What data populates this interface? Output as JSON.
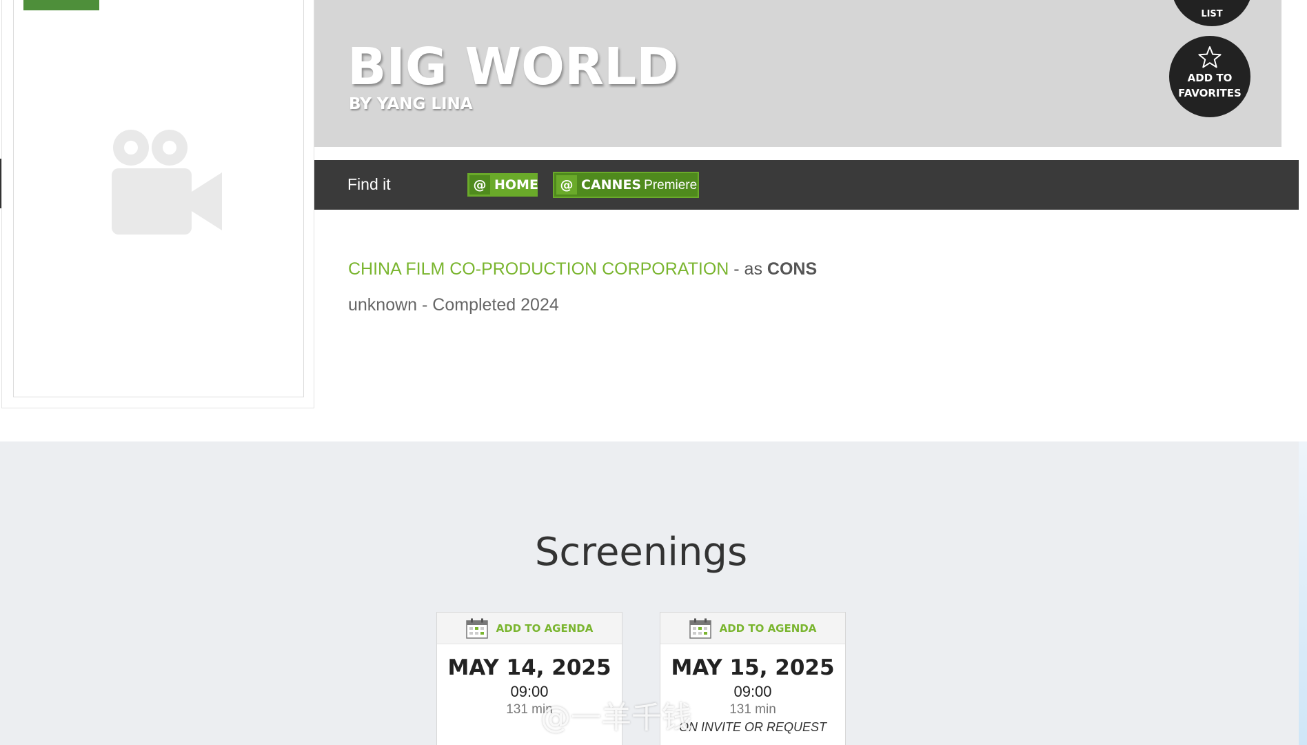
{
  "hero": {
    "title": "BIG WORLD",
    "subtitle": "BY YANG LINA",
    "list_button_label": "LIST",
    "favorites_button_label_line1": "ADD TO",
    "favorites_button_label_line2": "FAVORITES"
  },
  "find_it": {
    "label": "Find it",
    "tags": [
      {
        "label": "HOME",
        "sub": ""
      },
      {
        "label": "CANNES",
        "sub": "Premiere"
      }
    ]
  },
  "company": {
    "name": "CHINA FILM CO-PRODUCTION CORPORATION",
    "separator": " - as ",
    "role": "CONS"
  },
  "status": "unknown - Completed 2024",
  "screenings": {
    "title": "Screenings",
    "cards": [
      {
        "agenda_label": "ADD TO AGENDA",
        "date": "MAY 14, 2025",
        "time": "09:00",
        "duration": "131 min",
        "note": ""
      },
      {
        "agenda_label": "ADD TO AGENDA",
        "date": "MAY 15, 2025",
        "time": "09:00",
        "duration": "131 min",
        "note": "ON INVITE OR REQUEST"
      }
    ]
  },
  "watermark": "@一羊千钱",
  "colors": {
    "accent_green": "#7ab52f",
    "tag_green": "#6aaa2a",
    "dark_bar": "#3a3a3a",
    "hero_bg": "#d6d6d6",
    "section_bg": "#eceef1"
  },
  "icons": {
    "poster_placeholder": "video-camera-icon",
    "favorite": "star-icon",
    "agenda": "calendar-icon"
  }
}
